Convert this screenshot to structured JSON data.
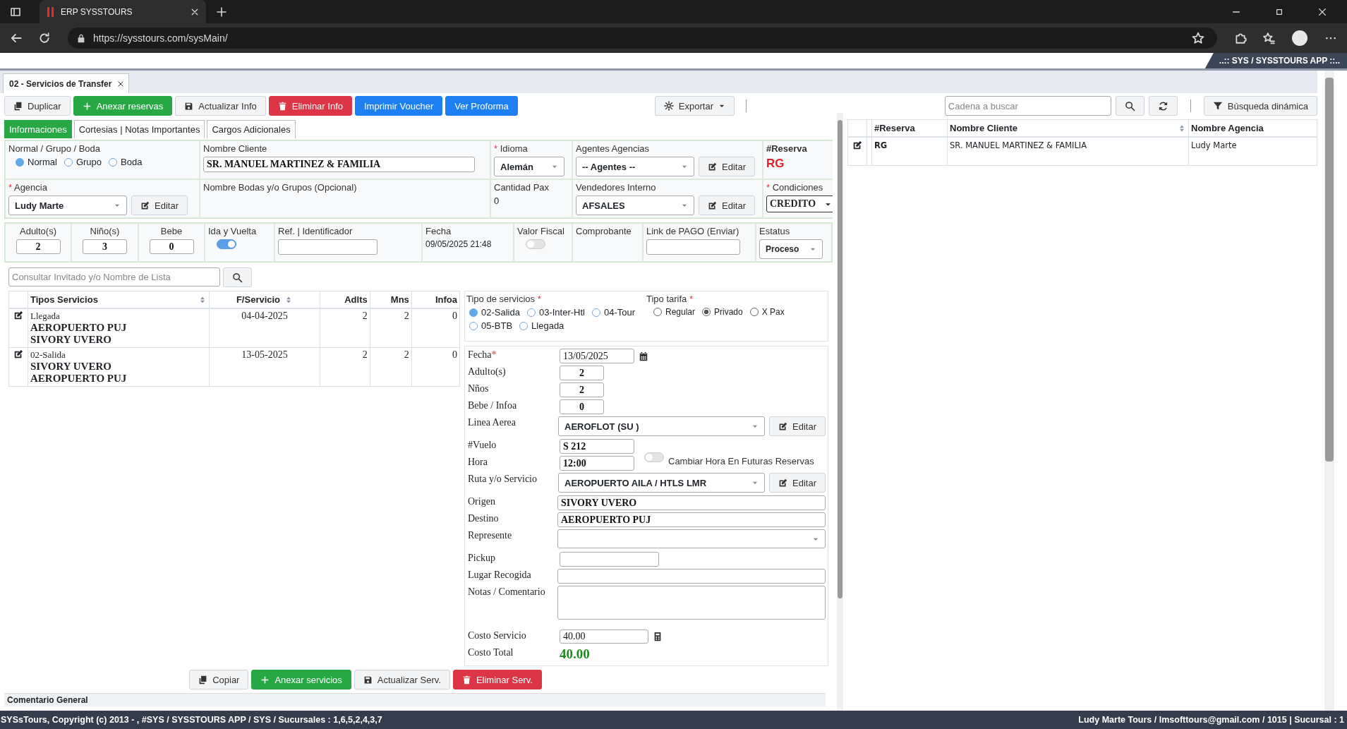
{
  "browser": {
    "tab_title": "ERP SYSSTOURS",
    "url": "https://sysstours.com/sysMain/"
  },
  "app_banner": "..:: SYS / SYSSTOURS APP ::..",
  "doc_tabs": [
    {
      "label": "02 - Servicios de Transfer",
      "selected": true
    }
  ],
  "toolbar": [
    {
      "label": "Duplicar",
      "kind": "default"
    },
    {
      "label": "Anexar reservas",
      "kind": "success"
    },
    {
      "label": "Actualizar Info",
      "kind": "default"
    },
    {
      "label": "Eliminar Info",
      "kind": "danger"
    },
    {
      "label": "Imprimir Voucher",
      "kind": "primary"
    },
    {
      "label": "Ver Proforma",
      "kind": "primary"
    }
  ],
  "export_button": "Exportar",
  "search": {
    "placeholder": "Cadena a buscar",
    "dynamic_button": "Búsqueda dinámica"
  },
  "form_tabs": [
    {
      "label": "Informaciones",
      "selected": true
    },
    {
      "label": "Cortesias | Notas Importantes",
      "selected": false
    },
    {
      "label": "Cargos Adicionales",
      "selected": false
    }
  ],
  "booking": {
    "mode": {
      "label": "Normal / Grupo / Boda",
      "options": [
        {
          "label": "Normal",
          "selected": true
        },
        {
          "label": "Grupo",
          "selected": false
        },
        {
          "label": "Boda",
          "selected": false
        }
      ]
    },
    "client": {
      "label": "Nombre Cliente",
      "value": "SR. MANUEL MARTINEZ & FAMILIA"
    },
    "language": {
      "label": "Idioma",
      "required": "*",
      "value": "Alemán"
    },
    "agents": {
      "label": "Agentes Agencias",
      "value": "-- Agentes --",
      "edit": "Editar"
    },
    "reservation": {
      "label": "#Reserva",
      "value": "RG"
    },
    "agency": {
      "label": "Agencia",
      "required": "*",
      "value": "Ludy Marte",
      "edit": "Editar"
    },
    "group_name": {
      "label": "Nombre Bodas y/o Grupos (Opcional)"
    },
    "pax_count": {
      "label": "Cantidad Pax",
      "value": "0"
    },
    "sellers": {
      "label": "Vendedores Interno",
      "value": "AFSALES",
      "edit": "Editar"
    },
    "conditions": {
      "label": "Condiciones",
      "required": "*",
      "value": "CREDITO"
    }
  },
  "pax": [
    {
      "label": "Adulto(s)",
      "value": "2"
    },
    {
      "label": "Niño(s)",
      "value": "3"
    },
    {
      "label": "Bebe",
      "value": "0"
    }
  ],
  "round_trip": {
    "label": "Ida y Vuelta",
    "on": true
  },
  "reference": {
    "label": "Ref. | Identificador"
  },
  "date": {
    "label": "Fecha",
    "value": "09/05/2025 21:48"
  },
  "fiscal_value": {
    "label": "Valor Fiscal",
    "on": false
  },
  "voucher": {
    "label": "Comprobante"
  },
  "payment_link": {
    "label": "Link de PAGO (Enviar)"
  },
  "status": {
    "label": "Estatus",
    "value": "Proceso"
  },
  "guest_search": {
    "placeholder": "Consultar Invitado y/o Nombre de Lista"
  },
  "services_table": {
    "columns": [
      "Tipos Servicios",
      "F/Servicio",
      "Adlts",
      "Mns",
      "Infoa"
    ],
    "rows": [
      {
        "type": "Llegada",
        "origin": "AEROPUERTO PUJ",
        "destination": "SIVORY UVERO",
        "date": "04-04-2025",
        "adults": "2",
        "minors": "2",
        "infants": "0"
      },
      {
        "type": "02-Salida",
        "origin": "SIVORY UVERO",
        "destination": "AEROPUERTO PUJ",
        "date": "13-05-2025",
        "adults": "2",
        "minors": "2",
        "infants": "0"
      }
    ]
  },
  "service_form": {
    "service_type": {
      "label": "Tipo de servicios",
      "required": "*",
      "options": [
        {
          "label": "02-Salida",
          "selected": true
        },
        {
          "label": "03-Inter-Htl",
          "selected": false
        },
        {
          "label": "04-Tour",
          "selected": false
        },
        {
          "label": "05-BTB",
          "selected": false
        },
        {
          "label": "Llegada",
          "selected": false
        }
      ]
    },
    "fare_type": {
      "label": "Tipo tarifa",
      "required": "*",
      "options": [
        {
          "label": "Regular",
          "selected": false
        },
        {
          "label": "Privado",
          "selected": true
        },
        {
          "label": "X Pax",
          "selected": false
        }
      ]
    },
    "fields": [
      {
        "kind": "date",
        "label": "Fecha",
        "required": "*",
        "value": "13/05/2025"
      },
      {
        "kind": "number",
        "label": "Adulto(s)",
        "value": "2"
      },
      {
        "kind": "number",
        "label": "Nños",
        "value": "2"
      },
      {
        "kind": "number",
        "label": "Bebe / Infoa",
        "value": "0"
      },
      {
        "kind": "select_edit",
        "label": "Linea Aerea",
        "value": "AEROFLOT (SU )",
        "edit": "Editar"
      },
      {
        "kind": "short",
        "label": "#Vuelo",
        "value": "S 212"
      },
      {
        "kind": "short",
        "label": "Hora",
        "value": "12:00",
        "toggle_label": "Cambiar Hora En Futuras Reservas",
        "toggle_on": false
      },
      {
        "kind": "select_edit",
        "label": "Ruta y/o Servicio",
        "value": "AEROPUERTO AILA / HTLS LMR",
        "edit": "Editar"
      },
      {
        "kind": "wide",
        "label": "Origen",
        "value": "SIVORY UVERO"
      },
      {
        "kind": "wide",
        "label": "Destino",
        "value": "AEROPUERTO PUJ"
      },
      {
        "kind": "select",
        "label": "Represente"
      },
      {
        "kind": "medium",
        "label": "Pickup"
      },
      {
        "kind": "wide",
        "label": "Lugar Recogida"
      },
      {
        "kind": "textarea",
        "label": "Notas / Comentario"
      },
      {
        "kind": "money",
        "label": "Costo Servicio",
        "value": "40.00"
      },
      {
        "kind": "total",
        "label": "Costo Total",
        "value": "40.00"
      }
    ]
  },
  "service_buttons": [
    {
      "label": "Copiar",
      "kind": "default"
    },
    {
      "label": "Anexar servicios",
      "kind": "success"
    },
    {
      "label": "Actualizar Serv.",
      "kind": "default"
    },
    {
      "label": "Eliminar Serv.",
      "kind": "danger"
    }
  ],
  "comment_section": "Comentario General",
  "results_table": {
    "columns": [
      "#Reserva",
      "Nombre Cliente",
      "Nombre Agencia"
    ],
    "rows": [
      {
        "reservation": "RG",
        "client": "SR. MANUEL MARTINEZ & FAMILIA",
        "agency": "Ludy Marte"
      }
    ]
  },
  "status_bar": {
    "left": "SYSsTours, Copyright (c) 2013 - , #SYS / SYSSTOURS APP / SYS / Sucursales : 1,6,5,2,4,3,7",
    "right": "Ludy Marte Tours / lmsofttours@gmail.com / 1015 | Sucursal : 1"
  }
}
